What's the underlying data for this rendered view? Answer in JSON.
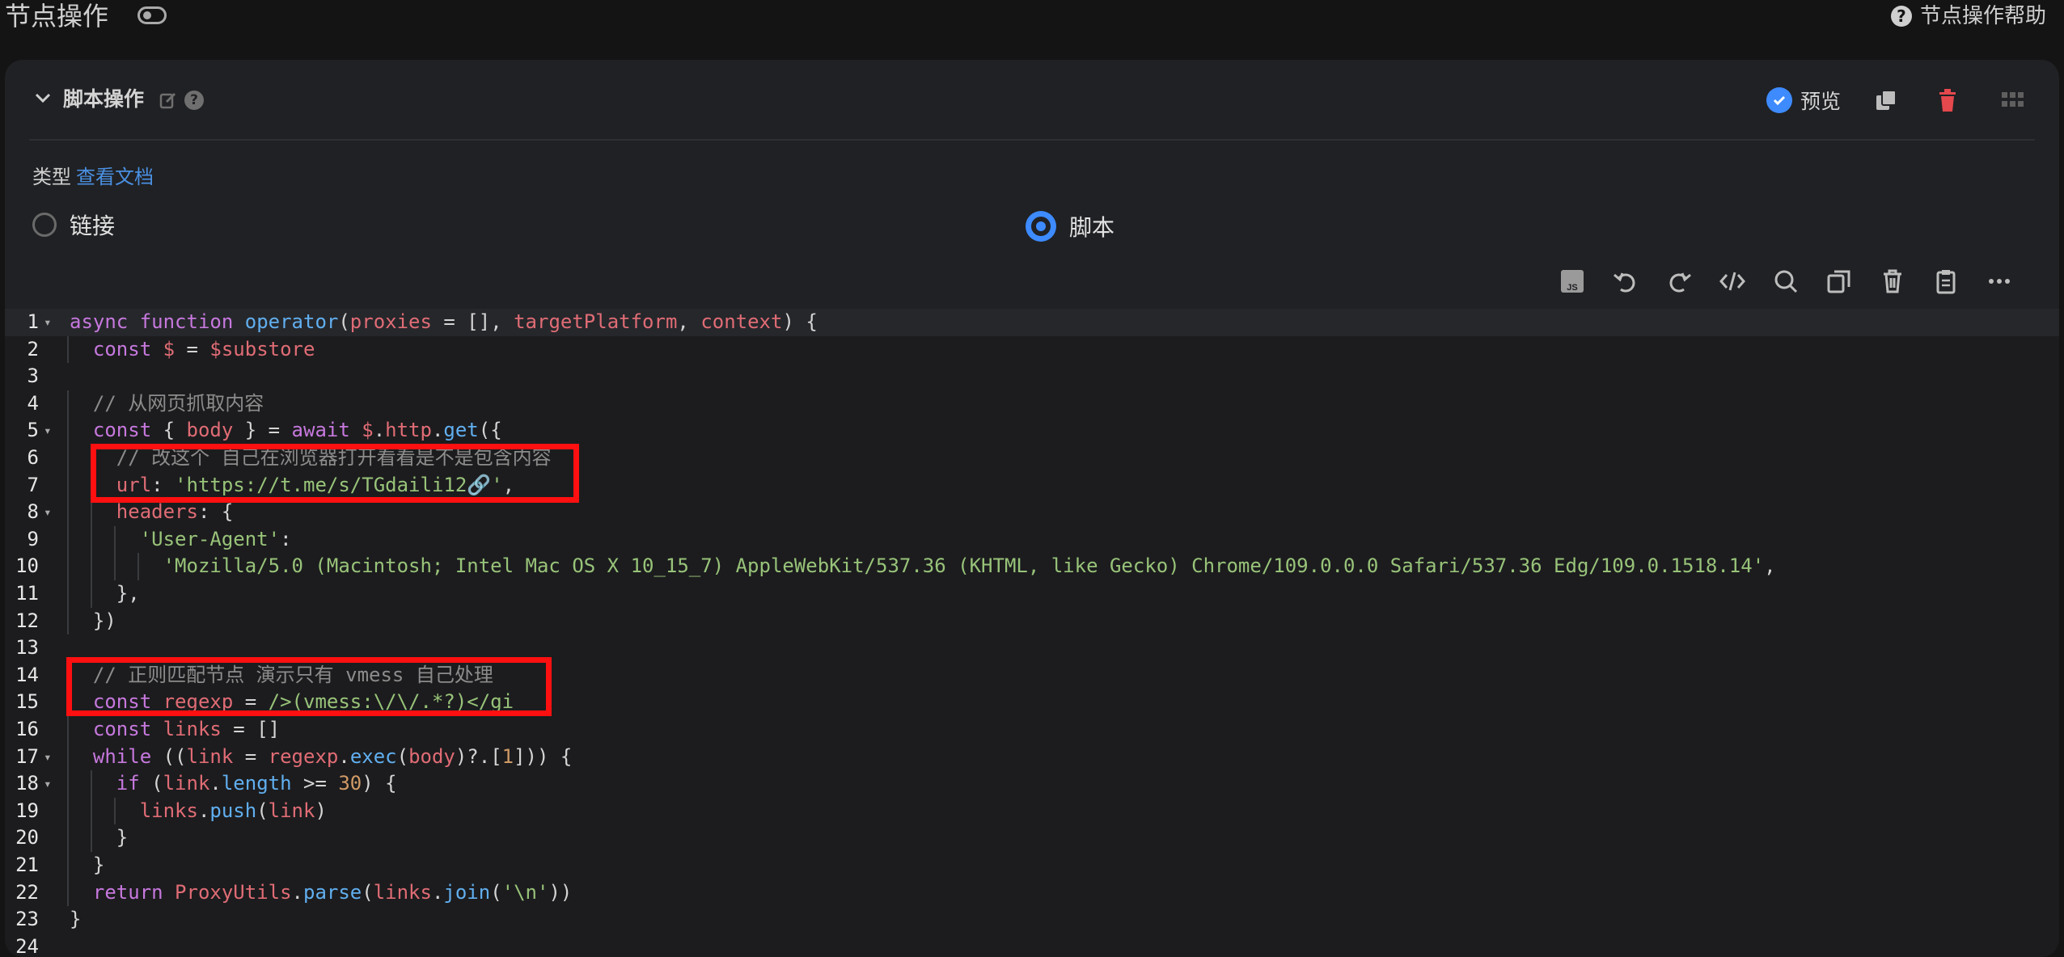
{
  "topbar": {
    "title": "节点操作",
    "help_label": "节点操作帮助"
  },
  "section": {
    "title": "脚本操作",
    "preview_label": "预览"
  },
  "type_row": {
    "label": "类型",
    "doc_link": "查看文档"
  },
  "radios": {
    "link_label": "链接",
    "script_label": "脚本",
    "selected": "脚本"
  },
  "toolbar": {
    "js_badge": "JS",
    "icons": [
      "js-icon",
      "undo-icon",
      "redo-icon",
      "code-icon",
      "search-icon",
      "copy-icon",
      "delete-icon",
      "paste-icon",
      "more-icon"
    ]
  },
  "colors": {
    "accent": "#3d8bff",
    "danger": "#e5484d",
    "highlight": "#ff1010"
  },
  "code": {
    "line_numbers": [
      "1",
      "2",
      "3",
      "4",
      "5",
      "6",
      "7",
      "8",
      "9",
      "10",
      "11",
      "12",
      "13",
      "14",
      "15",
      "16",
      "17",
      "18",
      "19",
      "20",
      "21",
      "22",
      "23",
      "24"
    ],
    "lines": [
      [
        [
          "kw",
          "async "
        ],
        [
          "kw",
          "function "
        ],
        [
          "fn",
          "operator"
        ],
        [
          "pl",
          "("
        ],
        [
          "var",
          "proxies"
        ],
        [
          "pl",
          " = [], "
        ],
        [
          "var",
          "targetPlatform"
        ],
        [
          "pl",
          ", "
        ],
        [
          "var",
          "context"
        ],
        [
          "pl",
          ") {"
        ]
      ],
      [
        [
          "kw",
          "const "
        ],
        [
          "var",
          "$"
        ],
        [
          "pl",
          " = "
        ],
        [
          "var",
          "$substore"
        ]
      ],
      [],
      [
        [
          "cm",
          "// 从网页抓取内容"
        ]
      ],
      [
        [
          "kw",
          "const "
        ],
        [
          "pl",
          "{ "
        ],
        [
          "var",
          "body"
        ],
        [
          "pl",
          " } = "
        ],
        [
          "kw",
          "await "
        ],
        [
          "var",
          "$"
        ],
        [
          "pl",
          "."
        ],
        [
          "var",
          "http"
        ],
        [
          "pl",
          "."
        ],
        [
          "fn",
          "get"
        ],
        [
          "pl",
          "({"
        ]
      ],
      [
        [
          "cm",
          "// 改这个 自己在浏览器打开看看是不是包含内容"
        ]
      ],
      [
        [
          "var",
          "url"
        ],
        [
          "pl",
          ": "
        ],
        [
          "str",
          "'https://t.me/s/TGdaili12"
        ],
        [
          "pl",
          "🔗"
        ],
        [
          "str",
          "'"
        ],
        [
          "pl",
          ","
        ]
      ],
      [
        [
          "var",
          "headers"
        ],
        [
          "pl",
          ": {"
        ]
      ],
      [
        [
          "str",
          "'User-Agent'"
        ],
        [
          "pl",
          ":"
        ]
      ],
      [
        [
          "str",
          "'Mozilla/5.0 (Macintosh; Intel Mac OS X 10_15_7) AppleWebKit/537.36 (KHTML, like Gecko) Chrome/109.0.0.0 Safari/537.36 Edg/109.0.1518.14'"
        ],
        [
          "pl",
          ","
        ]
      ],
      [
        [
          "pl",
          "},"
        ]
      ],
      [
        [
          "pl",
          "})"
        ]
      ],
      [],
      [
        [
          "cm",
          "// 正则匹配节点 演示只有 vmess 自己处理"
        ]
      ],
      [
        [
          "kw",
          "const "
        ],
        [
          "var",
          "regexp"
        ],
        [
          "pl",
          " = "
        ],
        [
          "str",
          "/>(vmess:\\/\\/.*?)</gi"
        ]
      ],
      [
        [
          "kw",
          "const "
        ],
        [
          "var",
          "links"
        ],
        [
          "pl",
          " = []"
        ]
      ],
      [
        [
          "kw",
          "while "
        ],
        [
          "pl",
          "(("
        ],
        [
          "var",
          "link"
        ],
        [
          "pl",
          " = "
        ],
        [
          "var",
          "regexp"
        ],
        [
          "pl",
          "."
        ],
        [
          "fn",
          "exec"
        ],
        [
          "pl",
          "("
        ],
        [
          "var",
          "body"
        ],
        [
          "pl",
          ")?.["
        ],
        [
          "num",
          "1"
        ],
        [
          "pl",
          "])) {"
        ]
      ],
      [
        [
          "kw",
          "if "
        ],
        [
          "pl",
          "("
        ],
        [
          "var",
          "link"
        ],
        [
          "pl",
          "."
        ],
        [
          "fn",
          "length"
        ],
        [
          "pl",
          " >= "
        ],
        [
          "num",
          "30"
        ],
        [
          "pl",
          ") {"
        ]
      ],
      [
        [
          "var",
          "links"
        ],
        [
          "pl",
          "."
        ],
        [
          "fn",
          "push"
        ],
        [
          "pl",
          "("
        ],
        [
          "var",
          "link"
        ],
        [
          "pl",
          ")"
        ]
      ],
      [
        [
          "pl",
          "}"
        ]
      ],
      [
        [
          "pl",
          "}"
        ]
      ],
      [
        [
          "kw",
          "return "
        ],
        [
          "var",
          "ProxyUtils"
        ],
        [
          "pl",
          "."
        ],
        [
          "fn",
          "parse"
        ],
        [
          "pl",
          "("
        ],
        [
          "var",
          "links"
        ],
        [
          "pl",
          "."
        ],
        [
          "fn",
          "join"
        ],
        [
          "pl",
          "("
        ],
        [
          "str",
          "'\\n'"
        ],
        [
          "pl",
          "))"
        ]
      ],
      [
        [
          "pl",
          "}"
        ]
      ],
      []
    ]
  }
}
